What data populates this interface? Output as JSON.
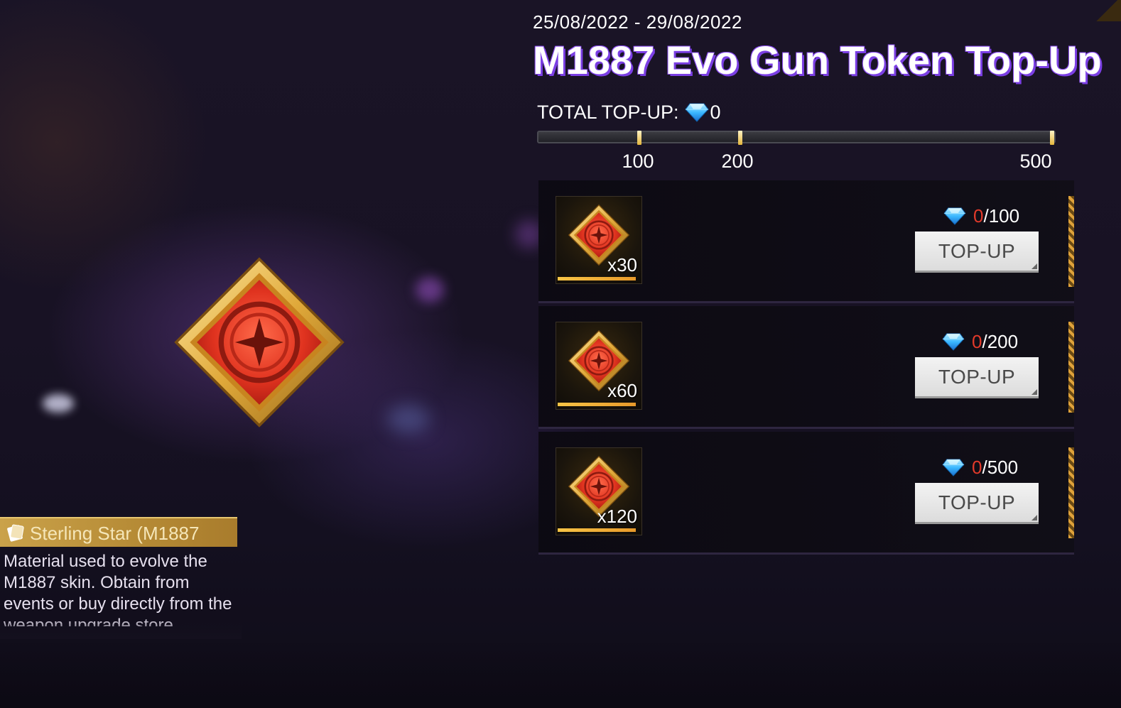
{
  "event": {
    "date_range": "25/08/2022 - 29/08/2022",
    "title": "M1887 Evo Gun Token Top-Up",
    "total_label": "TOTAL TOP-UP:",
    "total_value": "0",
    "progress_fraction": 0
  },
  "milestones": [
    {
      "label": "100"
    },
    {
      "label": "200"
    },
    {
      "label": "500"
    }
  ],
  "rewards": [
    {
      "quantity": "x30",
      "current": "0",
      "required": "/100",
      "button": "TOP-UP"
    },
    {
      "quantity": "x60",
      "current": "0",
      "required": "/200",
      "button": "TOP-UP"
    },
    {
      "quantity": "x120",
      "current": "0",
      "required": "/500",
      "button": "TOP-UP"
    }
  ],
  "item": {
    "name": "Sterling Star (M1887",
    "description": "Material used to evolve the M1887 skin. Obtain from events or buy directly from the weapon upgrade store"
  },
  "colors": {
    "accent_gold": "#f0c24e",
    "title_outline": "#7b3fe4",
    "progress_current": "#e23a2a",
    "diamond": "#3ab8ff"
  },
  "icons": {
    "diamond": "diamond-icon",
    "token": "sterling-star-token-icon",
    "ticket": "ticket-icon"
  }
}
